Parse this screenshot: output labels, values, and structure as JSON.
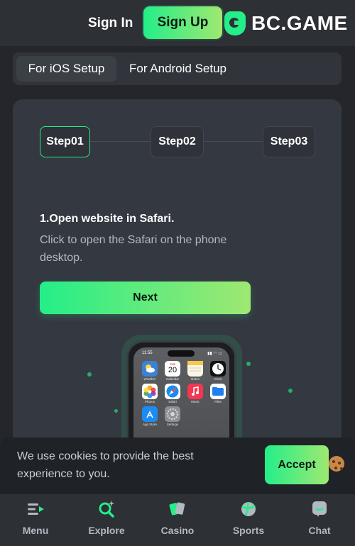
{
  "header": {
    "sign_in": "Sign In",
    "sign_up": "Sign Up",
    "logo_text": "BC.GAME"
  },
  "setup_tabs": [
    {
      "label": "For iOS Setup",
      "selected": true
    },
    {
      "label": "For Android Setup",
      "selected": false
    }
  ],
  "steps": [
    {
      "label": "Step01",
      "active": true
    },
    {
      "label": "Step02",
      "active": false
    },
    {
      "label": "Step03",
      "active": false
    }
  ],
  "instruction": {
    "title": "1.Open website in Safari.",
    "description": "Click to open the Safari on the phone desktop."
  },
  "next_button": "Next",
  "phone": {
    "time": "11:55",
    "apps": [
      {
        "label": "Weather",
        "color": "#3b82d6"
      },
      {
        "label": "Calendar",
        "color": "#ffffff",
        "text_top": "TUE",
        "text_main": "20"
      },
      {
        "label": "Notes",
        "color": "#f5f0d6"
      },
      {
        "label": "Clock",
        "color": "#1a1a1a"
      },
      {
        "label": "Photos",
        "color": "#ffffff"
      },
      {
        "label": "Safari",
        "color": "#1a8cf0"
      },
      {
        "label": "Music",
        "color": "#f5364f"
      },
      {
        "label": "Files",
        "color": "#1f7ff0"
      },
      {
        "label": "App Store",
        "color": "#1b8cf3"
      },
      {
        "label": "Settings",
        "color": "#8e8e93"
      }
    ]
  },
  "cookie_banner": {
    "text": "We use cookies to provide the best experience to you.",
    "accept": "Accept"
  },
  "bottom_nav": [
    {
      "label": "Menu",
      "icon": "menu-icon"
    },
    {
      "label": "Explore",
      "icon": "explore-icon"
    },
    {
      "label": "Casino",
      "icon": "casino-icon"
    },
    {
      "label": "Sports",
      "icon": "sports-icon"
    },
    {
      "label": "Chat",
      "icon": "chat-icon"
    }
  ],
  "colors": {
    "accent_start": "#24ee89",
    "accent_end": "#9fe871",
    "background": "#24262b",
    "card": "#343840"
  }
}
